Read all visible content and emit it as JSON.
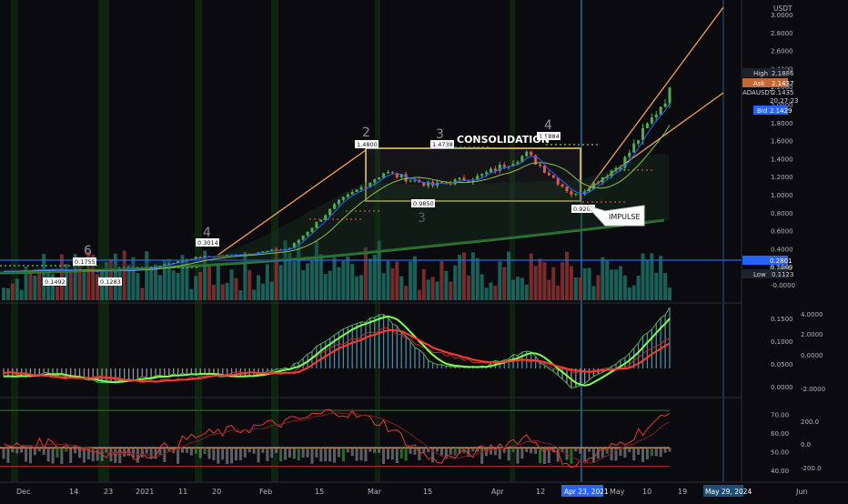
{
  "symbol_name": "ADAUSDT",
  "quote_currency": "USDT",
  "colors": {
    "background": "#0b0b0f",
    "up": "#26a69a",
    "down": "#ef5350",
    "green_line": "#4caf50",
    "red_line": "#e53935",
    "orange": "#f5a15b",
    "blue_line": "#2962ff",
    "crosshair": "#2e86c1"
  },
  "price_badges": {
    "high": {
      "label": "High",
      "value": "2.1886"
    },
    "ask": {
      "label": "Ask",
      "value": "2.1437"
    },
    "last": {
      "label": "ADAUSDT",
      "value": "2.1435",
      "time": "20:27:23"
    },
    "bid": {
      "label": "Bid",
      "value": "2.1429"
    },
    "line": {
      "value": "0.2801"
    },
    "line2": {
      "value": "0.2480"
    },
    "low": {
      "label": "Low",
      "value": "0.1123"
    }
  },
  "annotations": {
    "consolidation": "CONSOLIDATION",
    "impulse": "IMPULSE",
    "wave_labels": [
      "6",
      "4",
      "2",
      "3",
      "4",
      "3"
    ],
    "value_tags": [
      "0.1755",
      "0.1492",
      "0.1283",
      "0.3014",
      "1.4800",
      "1.4738",
      "1.5884",
      "0.9850",
      "0.9200"
    ]
  },
  "x_axis": {
    "ticks": [
      "Dec",
      "14",
      "23",
      "2021",
      "11",
      "20",
      "Feb",
      "15",
      "Mar",
      "15",
      "Apr",
      "12",
      "Apr 23, 2021",
      "May",
      "10",
      "19",
      "May 29, 2024",
      "Jun"
    ]
  },
  "chart_data": [
    {
      "type": "line",
      "title": "ADAUSDT",
      "y_axis_ticks": [
        "3.0000",
        "2.8000",
        "2.6000",
        "2.4000",
        "2.2000",
        "2.0000",
        "1.8000",
        "1.6000",
        "1.4000",
        "1.2000",
        "1.0000",
        "0.8000",
        "0.6000",
        "0.4000",
        "0.2000",
        "-0.0000"
      ],
      "ylim": [
        -0.05,
        3.05
      ],
      "x": [
        "Dec 1",
        "Dec 14",
        "Dec 23",
        "Jan 1",
        "Jan 11",
        "Jan 20",
        "Feb 1",
        "Feb 15",
        "Mar 1",
        "Mar 15",
        "Apr 1",
        "Apr 12",
        "Apr 23",
        "May 1",
        "May 10"
      ],
      "series": [
        {
          "values": [
            0.15,
            0.17,
            0.15,
            0.18,
            0.3,
            0.34,
            0.4,
            0.9,
            1.25,
            1.1,
            1.2,
            1.45,
            0.98,
            1.35,
            2.14
          ]
        }
      ]
    },
    {
      "type": "line",
      "y_axis_ticks": [
        "0.1500",
        "0.1000",
        "0.0500",
        "0.0000"
      ],
      "y_axis_ticks_right": [
        "4.0000",
        "2.0000",
        "0.0000",
        "-2.0000"
      ],
      "ylim": [
        -0.01,
        0.17
      ],
      "series": [
        {
          "values": [
            0.02,
            0.03,
            0.01,
            0.02,
            0.03,
            0.02,
            0.04,
            0.12,
            0.16,
            0.05,
            0.04,
            0.08,
            -0.005,
            0.06,
            0.17
          ]
        },
        {
          "values": [
            0.03,
            0.02,
            0.02,
            0.01,
            0.02,
            0.03,
            0.03,
            0.09,
            0.13,
            0.08,
            0.05,
            0.06,
            0.03,
            0.04,
            0.11
          ]
        }
      ]
    },
    {
      "type": "line",
      "y_axis_ticks": [
        "70.00",
        "60.00",
        "50.00",
        "40.00"
      ],
      "y_axis_ticks_right": [
        "200.0",
        "0.0",
        "-200.0"
      ],
      "ylim": [
        35,
        75
      ],
      "series": [
        {
          "values": [
            52,
            55,
            50,
            48,
            58,
            62,
            66,
            72,
            65,
            45,
            50,
            58,
            42,
            55,
            70
          ]
        }
      ]
    }
  ]
}
